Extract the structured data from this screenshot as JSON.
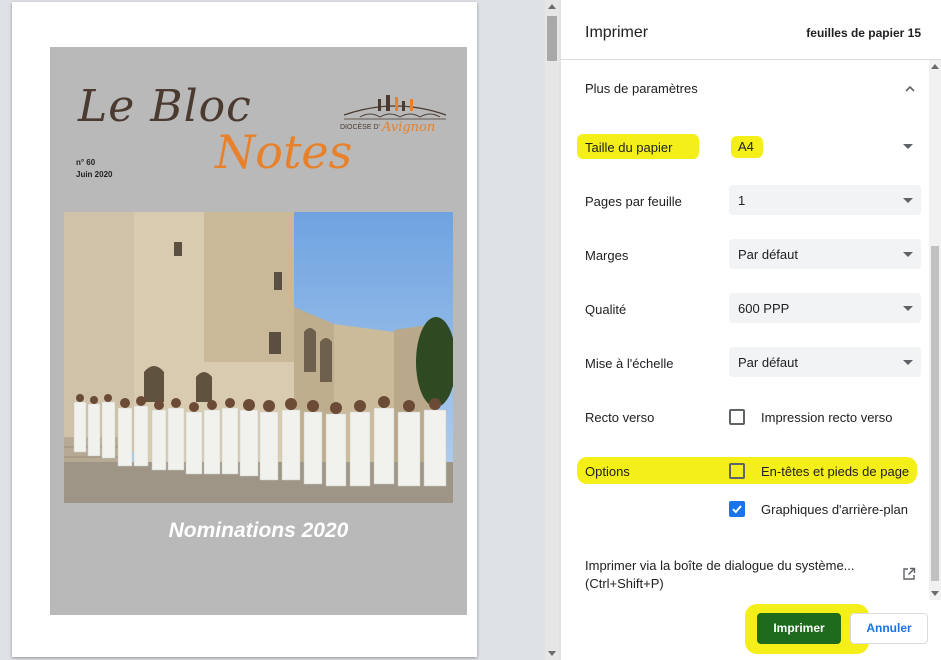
{
  "preview": {
    "magazine": {
      "title_part1": "Le Bloc",
      "title_part2": "Notes",
      "issue_number": "n° 60",
      "issue_date": "Juin 2020",
      "logo_text": "DIOCÈSE D'Avignon",
      "cover_caption": "Nominations 2020"
    }
  },
  "panel": {
    "header": {
      "title": "Imprimer",
      "sheets_info": "feuilles de papier 15"
    },
    "more_settings": {
      "label": "Plus de paramètres",
      "icon": "chevron-up-icon"
    },
    "settings": {
      "paper_size": {
        "label": "Taille du papier",
        "value": "A4"
      },
      "pages_per_sheet": {
        "label": "Pages par feuille",
        "value": "1"
      },
      "margins": {
        "label": "Marges",
        "value": "Par défaut"
      },
      "quality": {
        "label": "Qualité",
        "value": "600 PPP"
      },
      "scale": {
        "label": "Mise à l'échelle",
        "value": "Par défaut"
      },
      "duplex": {
        "label": "Recto verso",
        "option": "Impression recto verso",
        "checked": false
      },
      "options": {
        "label": "Options",
        "headers_footers": {
          "label": "En-têtes et pieds de page",
          "checked": false
        },
        "background_graphics": {
          "label": "Graphiques d'arrière-plan",
          "checked": true
        }
      }
    },
    "system_dialog": {
      "line1": "Imprimer via la boîte de dialogue du système...",
      "line2": "(Ctrl+Shift+P)",
      "icon": "open-in-new-icon"
    },
    "buttons": {
      "print": "Imprimer",
      "cancel": "Annuler"
    }
  },
  "colors": {
    "highlight": "#f5ef19",
    "print_button": "#1e6b1e",
    "accent_blue": "#1a73e8",
    "cover_orange": "#e8812b"
  }
}
